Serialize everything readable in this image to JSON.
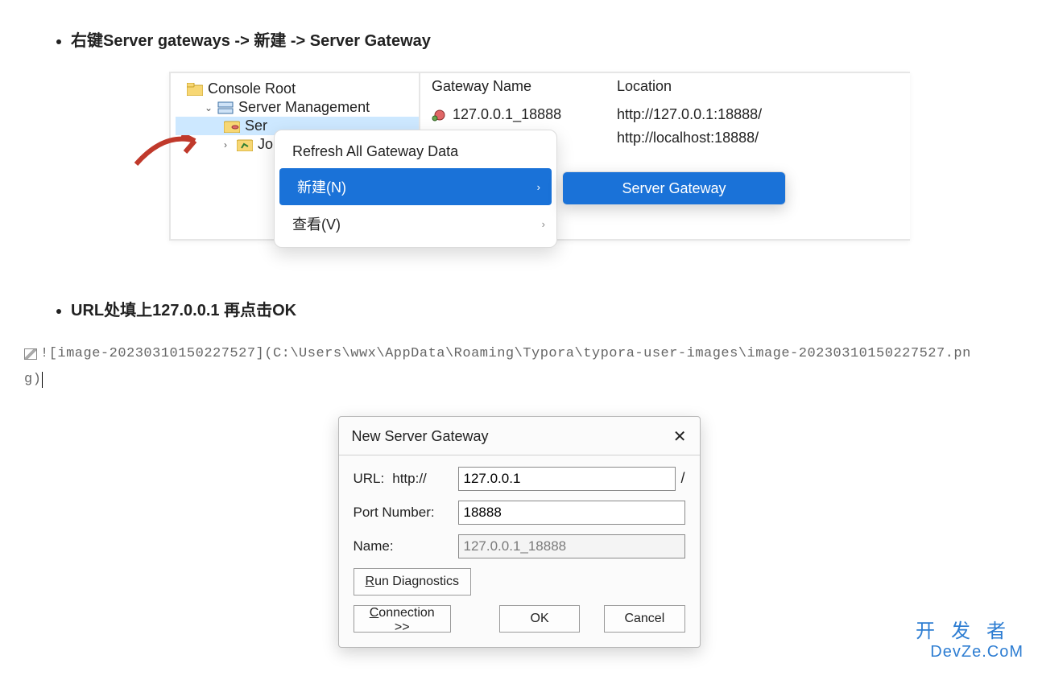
{
  "steps": {
    "s1": "右键Server gateways -> 新建 -> Server Gateway",
    "s2": "URL处填上127.0.0.1 再点击OK"
  },
  "tree": {
    "root": "Console Root",
    "server_mgmt": "Server Management",
    "server_gateways_prefix": "Ser",
    "jobs_prefix": "Job"
  },
  "list": {
    "header_gw": "Gateway Name",
    "header_loc": "Location",
    "rows": [
      {
        "name": "127.0.0.1_18888",
        "loc": "http://127.0.0.1:18888/"
      },
      {
        "name": "",
        "loc": "http://localhost:18888/"
      }
    ]
  },
  "ctx": {
    "refresh": "Refresh All Gateway Data",
    "new": "新建(N)",
    "view": "查看(V)"
  },
  "submenu": {
    "server_gateway": "Server Gateway"
  },
  "mdline": {
    "text_a": "![image-20230310150227527](C:\\Users\\wwx\\AppData\\Roaming\\Typora\\typora-user-images\\image-20230310150227527.pn",
    "text_b": "g)"
  },
  "dialog": {
    "title": "New Server Gateway",
    "url_label": "URL:",
    "url_scheme": "http://",
    "url_value": "127.0.0.1",
    "slash": "/",
    "port_label": "Port Number:",
    "port_value": "18888",
    "name_label": "Name:",
    "name_value": "127.0.0.1_18888",
    "run_diag": "Run Diagnostics",
    "connection": "Connection >>",
    "ok": "OK",
    "cancel": "Cancel"
  },
  "watermark": {
    "cn": "开发者",
    "en": "DevZe.CoM"
  }
}
